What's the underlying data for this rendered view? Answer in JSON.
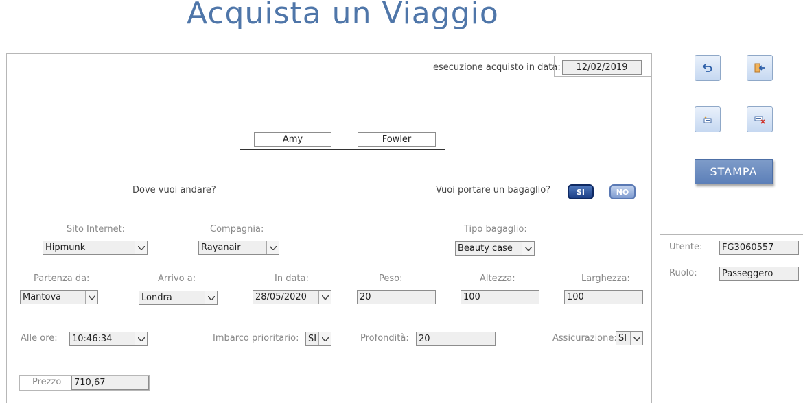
{
  "header": {
    "title": "Acquista un Viaggio"
  },
  "purchase": {
    "date_label": "esecuzione acquisto in data:",
    "date_value": "12/02/2019"
  },
  "customer": {
    "first_name": "Amy",
    "last_name": "Fowler"
  },
  "questions": {
    "destination": "Dove vuoi andare?",
    "luggage": "Vuoi portare un bagaglio?"
  },
  "luggage_toggle": {
    "yes": "SI",
    "no": "NO"
  },
  "travel": {
    "site_label": "Sito Internet:",
    "site_value": "Hipmunk",
    "company_label": "Compagnia:",
    "company_value": "Rayanair",
    "departure_label": "Partenza da:",
    "departure_value": "Mantova",
    "arrival_label": "Arrivo a:",
    "arrival_value": "Londra",
    "date_label": "In data:",
    "date_value": "28/05/2020",
    "time_label": "Alle ore:",
    "time_value": "10:46:34",
    "priority_label": "Imbarco prioritario:",
    "priority_value": "SI"
  },
  "baggage": {
    "type_label": "Tipo bagaglio:",
    "type_value": "Beauty case",
    "weight_label": "Peso:",
    "weight_value": "20",
    "height_label": "Altezza:",
    "height_value": "100",
    "width_label": "Larghezza:",
    "width_value": "100",
    "depth_label": "Profondità:",
    "depth_value": "20",
    "insurance_label": "Assicurazione:",
    "insurance_value": "SI"
  },
  "price": {
    "label": "Prezzo",
    "value": "710,67"
  },
  "actions": {
    "print_label": "STAMPA"
  },
  "user": {
    "user_label": "Utente:",
    "user_value": "FG3060557",
    "role_label": "Ruolo:",
    "role_value": "Passeggero"
  },
  "colors": {
    "title": "#4f76a9",
    "button_fill": "#c6d8f1",
    "print_button": "#6c8cc0"
  }
}
